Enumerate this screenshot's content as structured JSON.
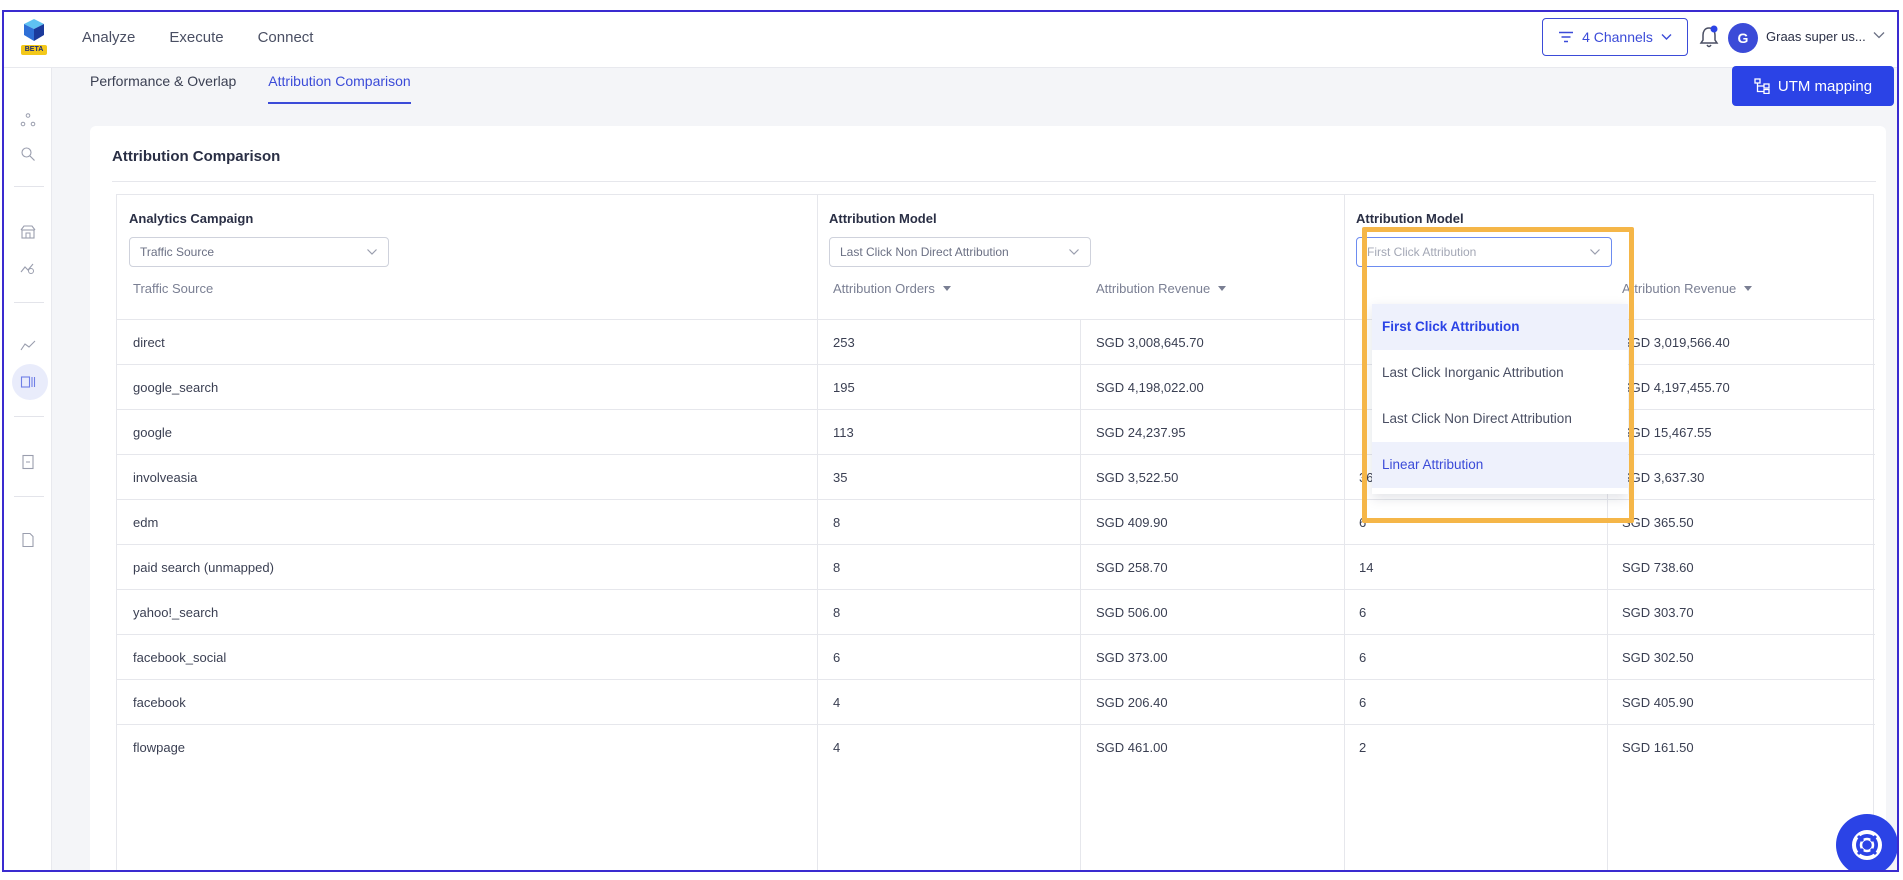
{
  "header": {
    "nav": [
      "Analyze",
      "Execute",
      "Connect"
    ],
    "logo_badge": "BETA",
    "channels_label": "4 Channels",
    "avatar_initial": "G",
    "user_name": "Graas super us..."
  },
  "tabs": [
    {
      "label": "Performance & Overlap",
      "active": false
    },
    {
      "label": "Attribution Comparison",
      "active": true
    }
  ],
  "utm_button": "UTM mapping",
  "card": {
    "title": "Attribution Comparison",
    "group1": {
      "label": "Analytics Campaign",
      "select_value": "Traffic Source"
    },
    "group2": {
      "label": "Attribution Model",
      "select_value": "Last Click Non Direct Attribution"
    },
    "group3": {
      "label": "Attribution Model",
      "select_placeholder": "First Click Attribution"
    },
    "columns": [
      "Traffic Source",
      "Attribution Orders",
      "Attribution Revenue",
      "Attribution Revenue"
    ],
    "rows": [
      {
        "source": "direct",
        "orders1": "253",
        "revenue1": "SGD 3,008,645.70",
        "orders2": "",
        "revenue2": "SGD 3,019,566.40"
      },
      {
        "source": "google_search",
        "orders1": "195",
        "revenue1": "SGD 4,198,022.00",
        "orders2": "",
        "revenue2": "SGD 4,197,455.70"
      },
      {
        "source": "google",
        "orders1": "113",
        "revenue1": "SGD 24,237.95",
        "orders2": "",
        "revenue2": "SGD 15,467.55"
      },
      {
        "source": "involveasia",
        "orders1": "35",
        "revenue1": "SGD 3,522.50",
        "orders2": "36",
        "revenue2": "SGD 3,637.30"
      },
      {
        "source": "edm",
        "orders1": "8",
        "revenue1": "SGD 409.90",
        "orders2": "6",
        "revenue2": "SGD 365.50"
      },
      {
        "source": "paid search (unmapped)",
        "orders1": "8",
        "revenue1": "SGD 258.70",
        "orders2": "14",
        "revenue2": "SGD 738.60"
      },
      {
        "source": "yahoo!_search",
        "orders1": "8",
        "revenue1": "SGD 506.00",
        "orders2": "6",
        "revenue2": "SGD 303.70"
      },
      {
        "source": "facebook_social",
        "orders1": "6",
        "revenue1": "SGD 373.00",
        "orders2": "6",
        "revenue2": "SGD 302.50"
      },
      {
        "source": "facebook",
        "orders1": "4",
        "revenue1": "SGD 206.40",
        "orders2": "6",
        "revenue2": "SGD 405.90"
      },
      {
        "source": "flowpage",
        "orders1": "4",
        "revenue1": "SGD 461.00",
        "orders2": "2",
        "revenue2": "SGD 161.50"
      }
    ]
  },
  "dropdown": {
    "options": [
      "First Click Attribution",
      "Last Click Inorganic Attribution",
      "Last Click Non Direct Attribution",
      "Linear Attribution"
    ],
    "highlight_color": "#f5b648"
  },
  "colors": {
    "accent": "#2b43e6",
    "frame": "#3a2bd0"
  }
}
